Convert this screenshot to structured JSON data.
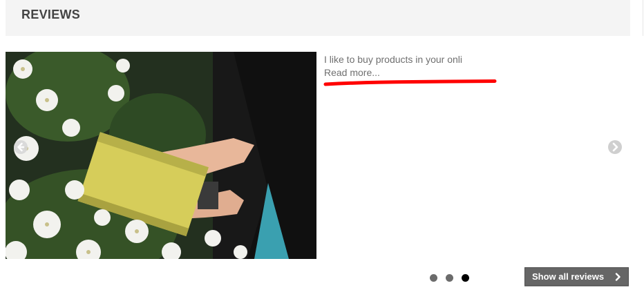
{
  "section": {
    "title": "REVIEWS"
  },
  "review": {
    "text": "I like to buy products in your onli",
    "read_more": "Read more..."
  },
  "carousel": {
    "prev_icon": "chevron-left-icon",
    "next_icon": "chevron-right-icon",
    "dots": 3,
    "active_dot": 3
  },
  "actions": {
    "show_all_label": "Show all reviews",
    "show_all_icon": "chevron-right-icon"
  },
  "colors": {
    "highlight": "#ff0000",
    "button_bg": "#666666",
    "header_bg": "#f4f4f4"
  }
}
